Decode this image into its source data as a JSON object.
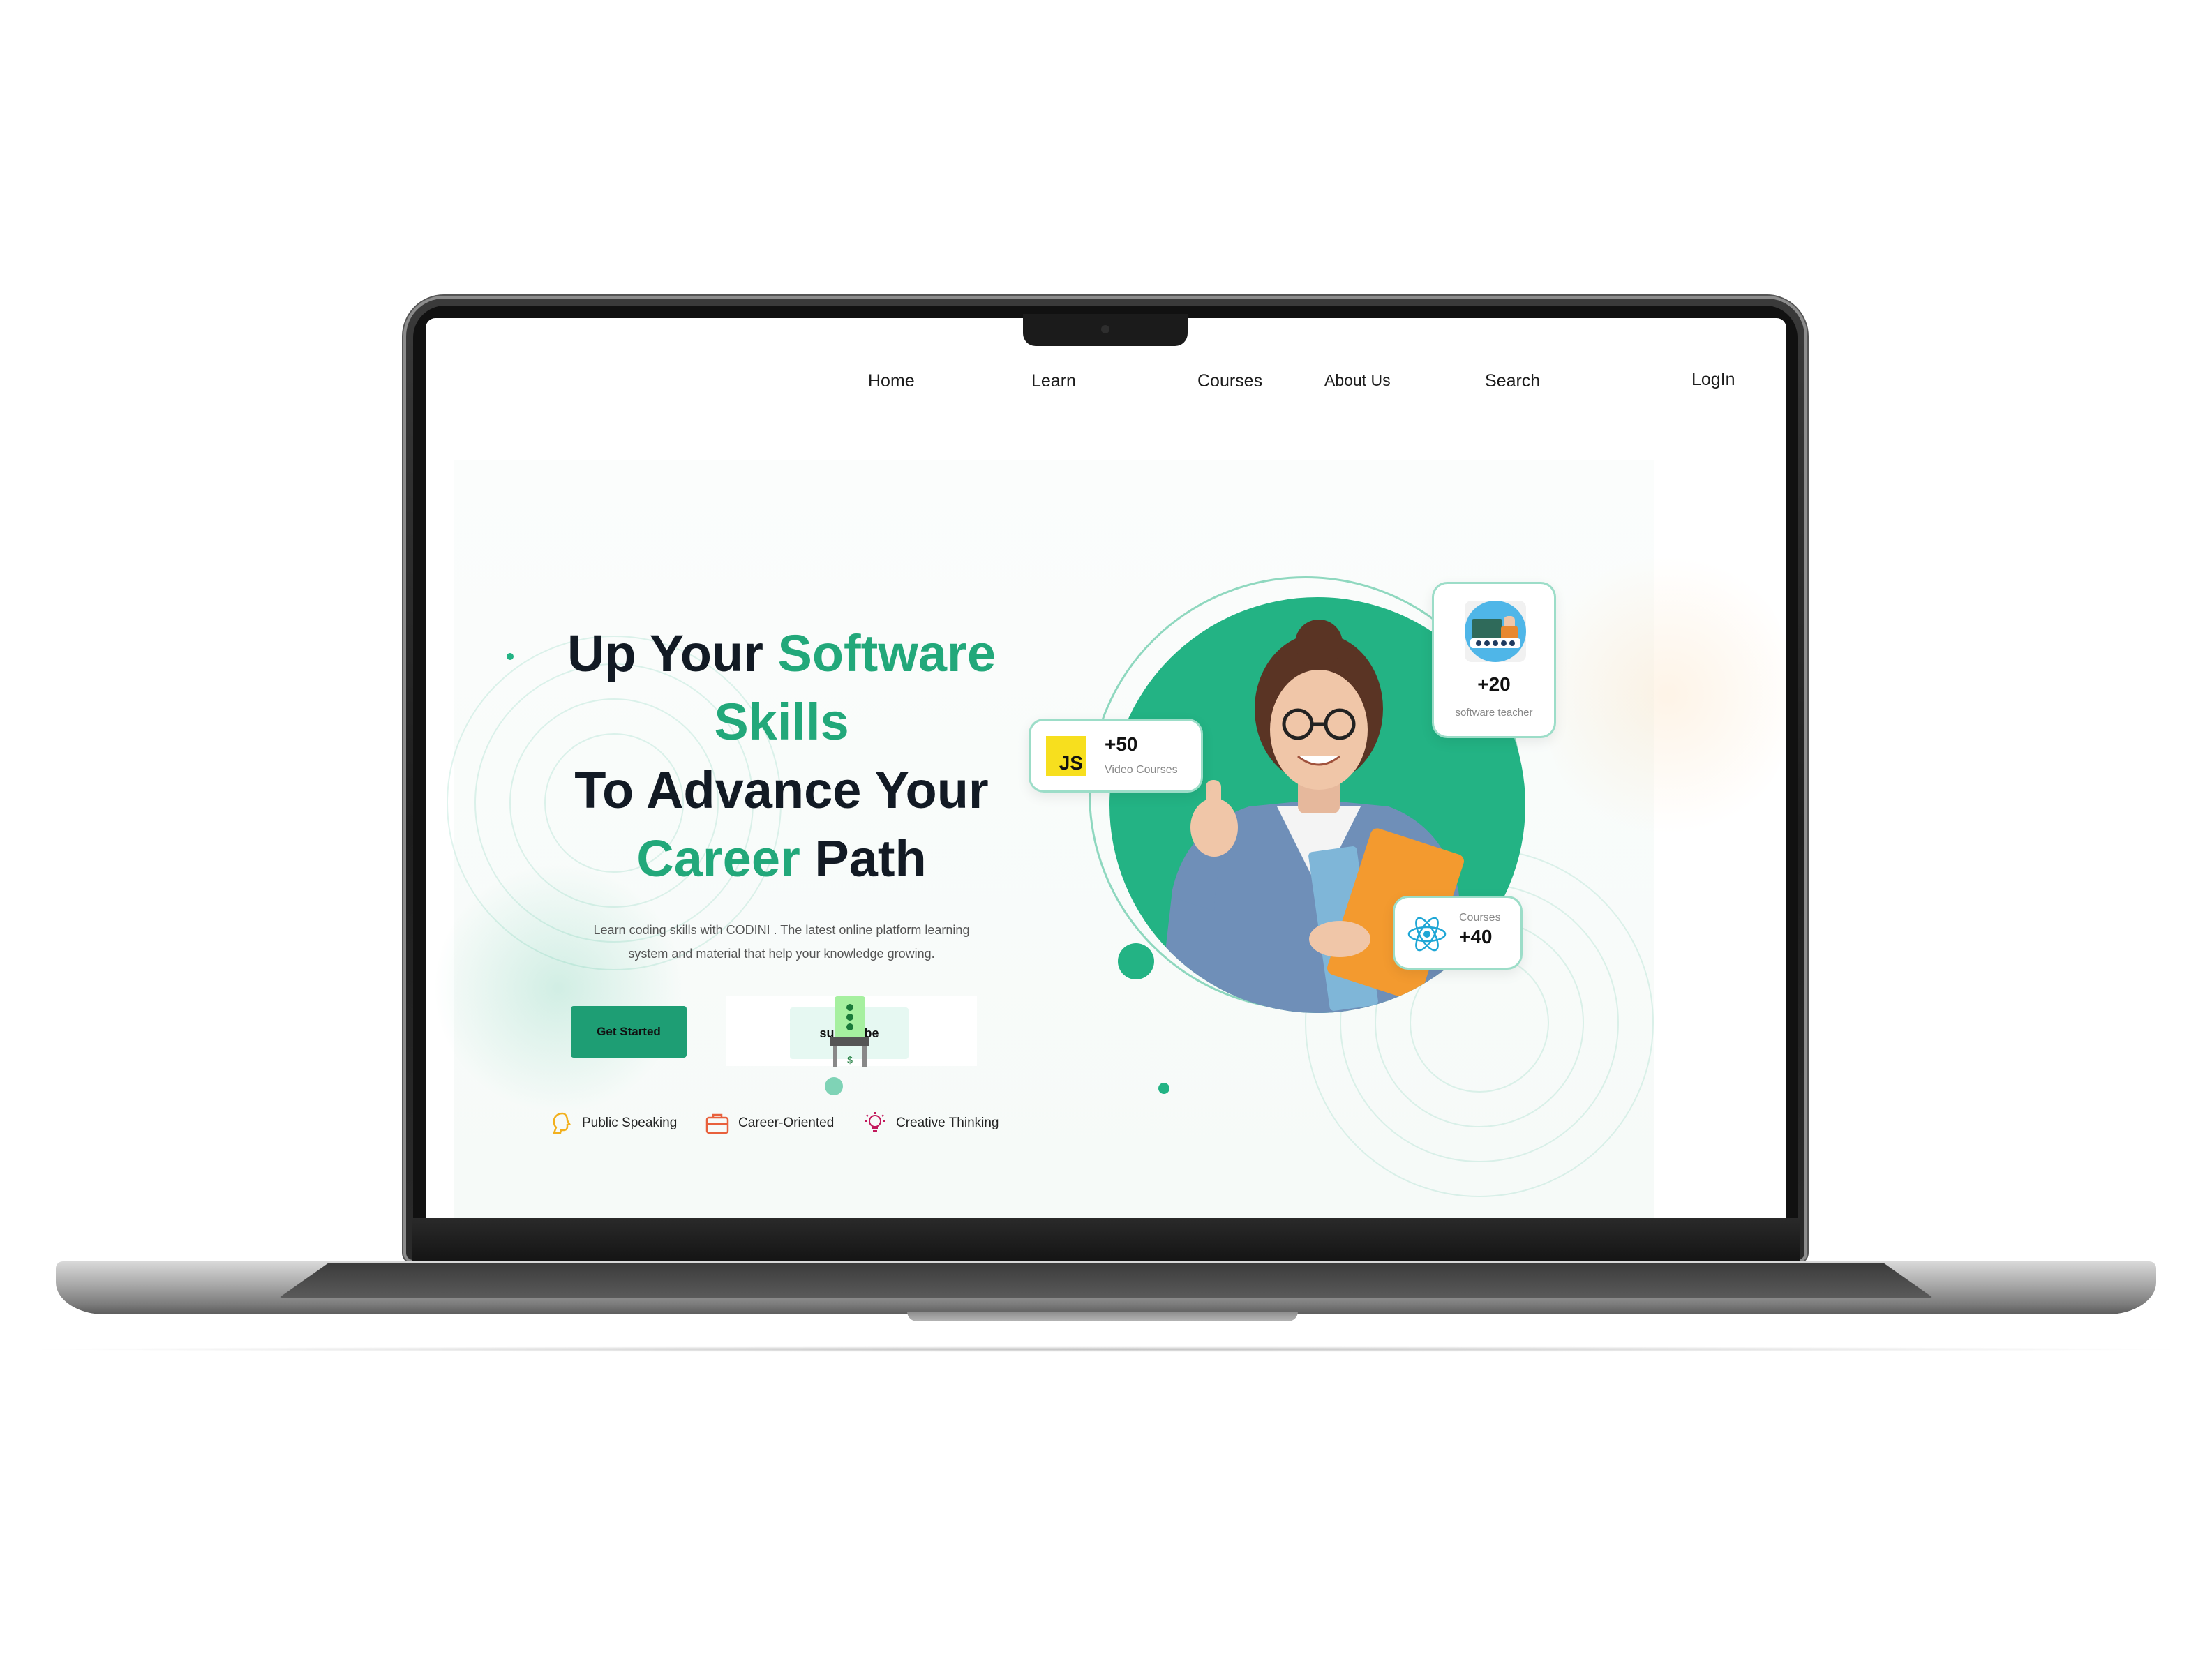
{
  "nav": {
    "home": "Home",
    "learn": "Learn",
    "courses": "Courses",
    "about": "About Us",
    "search": "Search",
    "login": "LogIn"
  },
  "hero": {
    "title_l1_a": "Up Your",
    "title_l1_b": "Software",
    "title_l2": "Skills",
    "title_l3": "To Advance Your",
    "title_l4_a": "Career",
    "title_l4_b": "Path",
    "subtitle_l1": "Learn coding skills with CODINI . The latest online platform learning",
    "subtitle_l2": "system and material that help your knowledge growing.",
    "cta_primary": "Get Started",
    "cta_secondary": "subscribe",
    "ticket_symbol": "$"
  },
  "skills": [
    {
      "label": "Public Speaking",
      "icon": "head-speaking-icon",
      "color": "#f2b01e"
    },
    {
      "label": "Career-Oriented",
      "icon": "briefcase-icon",
      "color": "#e8603c"
    },
    {
      "label": "Creative Thinking",
      "icon": "lightbulb-icon",
      "color": "#c2185b"
    }
  ],
  "cards": {
    "video": {
      "badge": "JS",
      "value": "+50",
      "label": "Video Courses"
    },
    "teacher": {
      "value": "+20",
      "label": "software teacher"
    },
    "courses": {
      "label": "Courses",
      "value": "+40"
    }
  },
  "colors": {
    "brand_green": "#23b384",
    "title_dark": "#121a24",
    "js_yellow": "#f7df1e",
    "react_blue": "#1fa7d6"
  }
}
